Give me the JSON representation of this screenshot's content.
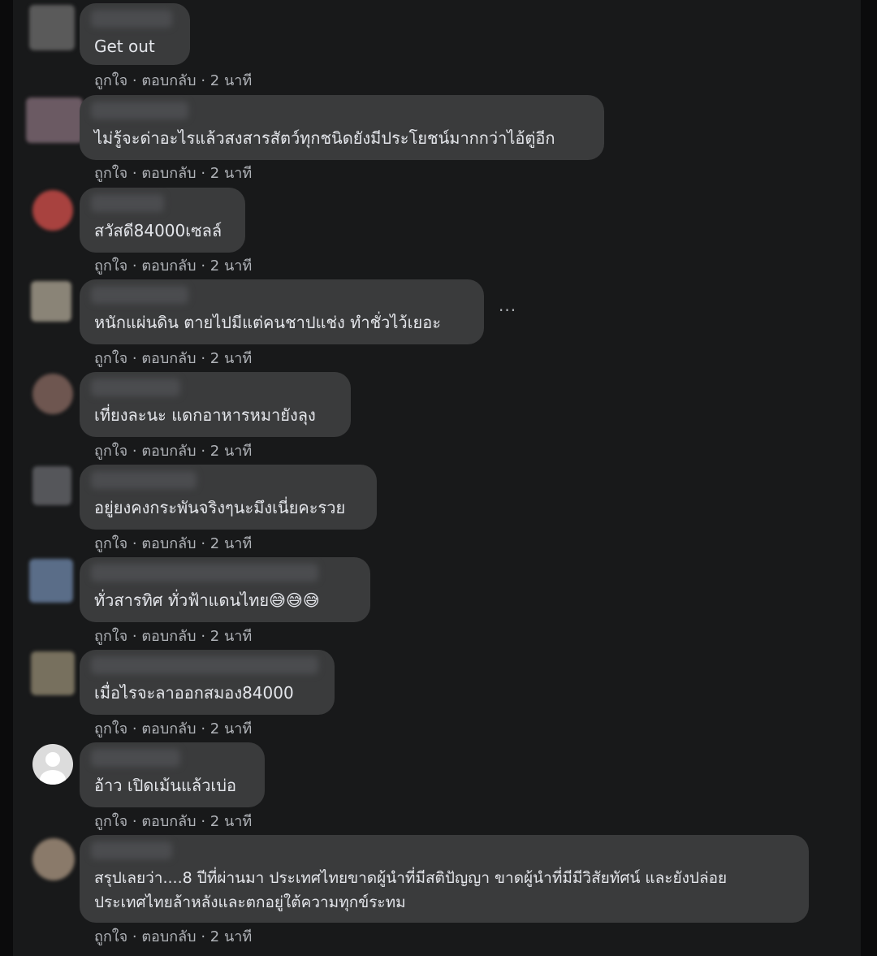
{
  "comments": [
    {
      "text": "Get out",
      "like": "ถูกใจ",
      "reply": "ตอบกลับ",
      "time": "2 นาที",
      "avatar_color": "#5a5a5a"
    },
    {
      "text": "ไม่รู้จะด่าอะไรแล้วสงสารสัตว์ทุกชนิดยังมีประโยชน์มากกว่าไอ้ตู่อีก",
      "like": "ถูกใจ",
      "reply": "ตอบกลับ",
      "time": "2 นาที",
      "avatar_color": "#6b5a63"
    },
    {
      "text": "สวัสดี84000เซลล์",
      "like": "ถูกใจ",
      "reply": "ตอบกลับ",
      "time": "2 นาที",
      "avatar_color": "#a8423f"
    },
    {
      "text": "หนักแผ่นดิน ตายไปมีแต่คนชาปแช่ง ทำชั่วไว้เยอะ",
      "like": "ถูกใจ",
      "reply": "ตอบกลับ",
      "time": "2 นาที",
      "avatar_color": "#8a8477",
      "more": "···"
    },
    {
      "text": "เที่ยงละนะ แดกอาหารหมายังลุง",
      "like": "ถูกใจ",
      "reply": "ตอบกลับ",
      "time": "2 นาที",
      "avatar_color": "#6e5650"
    },
    {
      "text": "อยู่ยงคงกระพันจริงๆนะมึงเนี่ยคะรวย",
      "like": "ถูกใจ",
      "reply": "ตอบกลับ",
      "time": "2 นาที",
      "avatar_color": "#55565a"
    },
    {
      "text": "ทั่วสารทิศ ทั่วฟ้าแดนไทย",
      "emoji": "😅😅😅",
      "like": "ถูกใจ",
      "reply": "ตอบกลับ",
      "time": "2 นาที",
      "avatar_color": "#5a6d88"
    },
    {
      "text": "เมื่อไรจะลาออกสมอง84000",
      "like": "ถูกใจ",
      "reply": "ตอบกลับ",
      "time": "2 นาที",
      "avatar_color": "#77705e"
    },
    {
      "text": "อ้าว เปิดเม้นแล้วเบ่อ",
      "like": "ถูกใจ",
      "reply": "ตอบกลับ",
      "time": "2 นาที",
      "avatar_color": "#dcdcdc"
    },
    {
      "text": "สรุปเลยว่า....8 ปีที่ผ่านมา ประเทศไทยขาดผู้นำที่มีสติปัญญา ขาดผู้นำที่มีมีวิสัยทัศน์ และยังปล่อยประเทศไทยล้าหลังและตกอยู่ใต้ความทุกข์ระทม",
      "like": "ถูกใจ",
      "reply": "ตอบกลับ",
      "time": "2 นาที",
      "avatar_color": "#8a7a6a"
    }
  ],
  "meta_separator": " · "
}
